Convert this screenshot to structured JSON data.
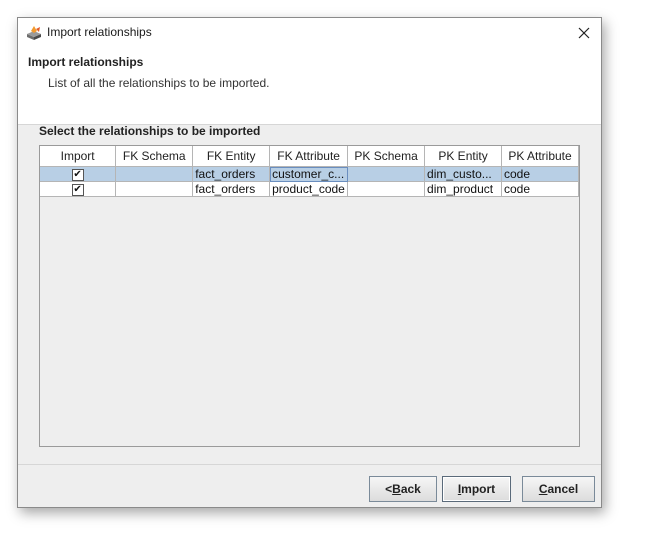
{
  "window": {
    "title": "Import relationships"
  },
  "header": {
    "title": "Import relationships",
    "subtitle": "List of all the relationships to be imported."
  },
  "section": {
    "label": "Select the relationships to be imported"
  },
  "table": {
    "columns": [
      "Import",
      "FK Schema",
      "FK Entity",
      "FK Attribute",
      "PK Schema",
      "PK Entity",
      "PK Attribute"
    ],
    "rows": [
      {
        "import": "✔",
        "fk_schema": "",
        "fk_entity": "fact_orders",
        "fk_attribute": "customer_c...",
        "pk_schema": "",
        "pk_entity": "dim_custo...",
        "pk_attribute": "code",
        "selected": true
      },
      {
        "import": "✔",
        "fk_schema": "",
        "fk_entity": "fact_orders",
        "fk_attribute": "product_code",
        "pk_schema": "",
        "pk_entity": "dim_product",
        "pk_attribute": "code",
        "selected": false
      }
    ]
  },
  "buttons": {
    "back_prefix": "< ",
    "back_mnemonic": "B",
    "back_rest": "ack",
    "import_mnemonic": "I",
    "import_rest": "mport",
    "cancel_mnemonic": "C",
    "cancel_rest": "ancel"
  },
  "icons": {
    "app": "app-logo-icon",
    "close": "close-icon"
  }
}
